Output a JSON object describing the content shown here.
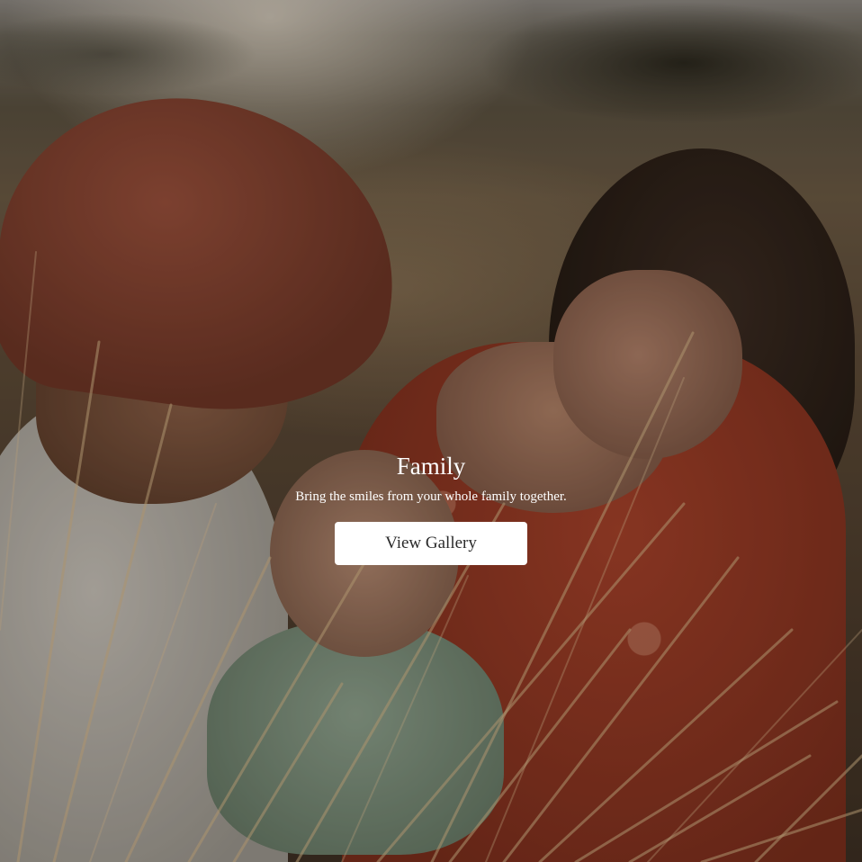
{
  "hero": {
    "title": "Family",
    "subtitle": "Bring the smiles from your whole family together.",
    "button_label": "View Gallery"
  }
}
